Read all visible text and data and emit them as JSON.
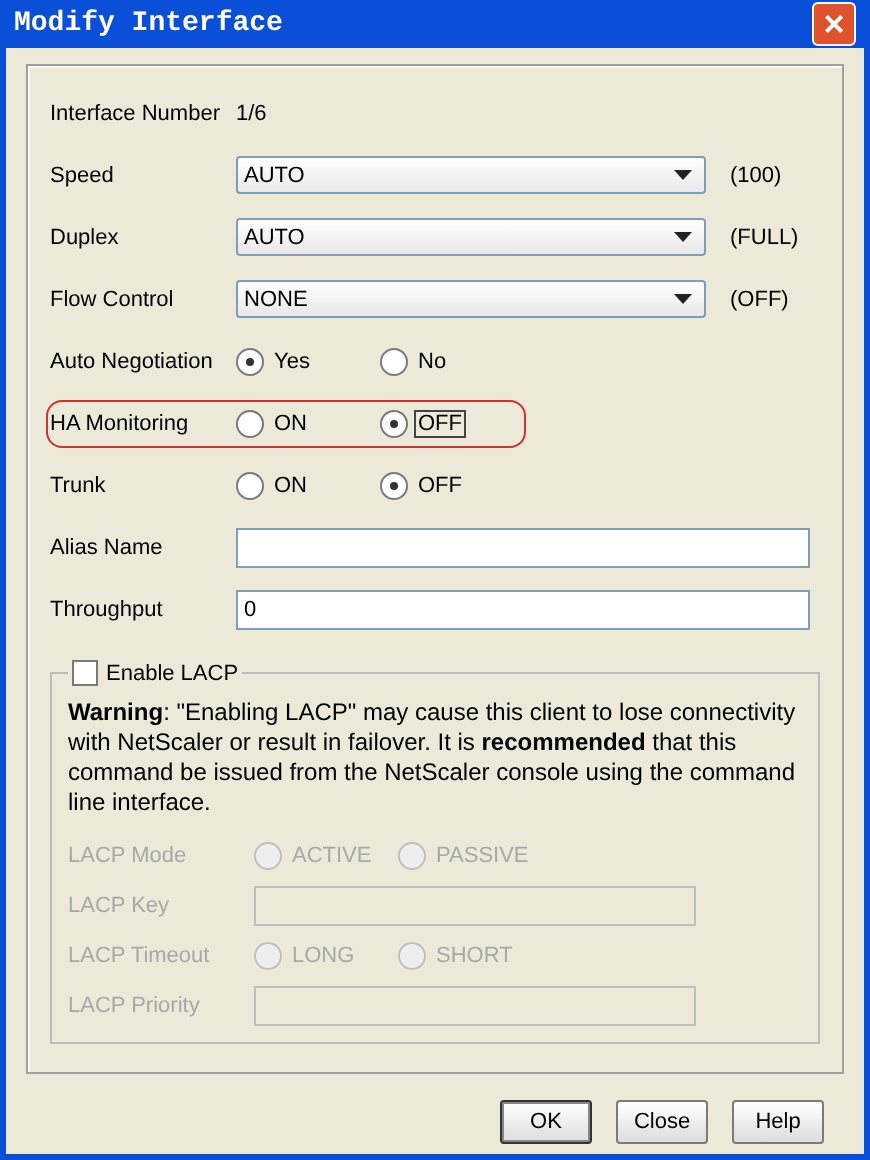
{
  "window": {
    "title": "Modify Interface",
    "close": "×"
  },
  "fields": [
    {
      "kind": "text",
      "label": "Interface Number",
      "value": "1/6"
    },
    {
      "kind": "select",
      "label": "Speed",
      "value": "AUTO",
      "note": "(100)"
    },
    {
      "kind": "select",
      "label": "Duplex",
      "value": "AUTO",
      "note": "(FULL)"
    },
    {
      "kind": "select",
      "label": "Flow Control",
      "value": "NONE",
      "note": "(OFF)"
    },
    {
      "kind": "radio",
      "label": "Auto Negotiation",
      "highlighted": false,
      "options": [
        {
          "label": "Yes",
          "selected": true,
          "focused": false
        },
        {
          "label": "No",
          "selected": false,
          "focused": false
        }
      ]
    },
    {
      "kind": "radio",
      "label": "HA Monitoring",
      "highlighted": true,
      "options": [
        {
          "label": "ON",
          "selected": false,
          "focused": false
        },
        {
          "label": "OFF",
          "selected": true,
          "focused": true
        }
      ]
    },
    {
      "kind": "radio",
      "label": "Trunk",
      "highlighted": false,
      "options": [
        {
          "label": "ON",
          "selected": false,
          "focused": false
        },
        {
          "label": "OFF",
          "selected": true,
          "focused": false
        }
      ]
    },
    {
      "kind": "input",
      "label": "Alias Name"
    },
    {
      "kind": "input",
      "label": "Throughput",
      "value": "0"
    }
  ],
  "lacp": {
    "label": "Enable LACP",
    "checked": false,
    "warning": "**Warning**: \"Enabling LACP\" may cause this client to lose connectivity with NetScaler or result in failover. It is **recommended** that this command be issued from the NetScaler console using the command line interface.",
    "fields": [
      {
        "kind": "radio",
        "label": "LACP Mode",
        "options": [
          {
            "label": "ACTIVE",
            "selected": false
          },
          {
            "label": "PASSIVE",
            "selected": false
          }
        ]
      },
      {
        "kind": "input",
        "label": "LACP Key"
      },
      {
        "kind": "radio",
        "label": "LACP Timeout",
        "options": [
          {
            "label": "LONG",
            "selected": false
          },
          {
            "label": "SHORT",
            "selected": false
          }
        ]
      },
      {
        "kind": "input",
        "label": "LACP Priority"
      }
    ]
  },
  "buttons": [
    {
      "label": "OK",
      "default": true
    },
    {
      "label": "Close",
      "default": false
    },
    {
      "label": "Help",
      "default": false
    }
  ]
}
